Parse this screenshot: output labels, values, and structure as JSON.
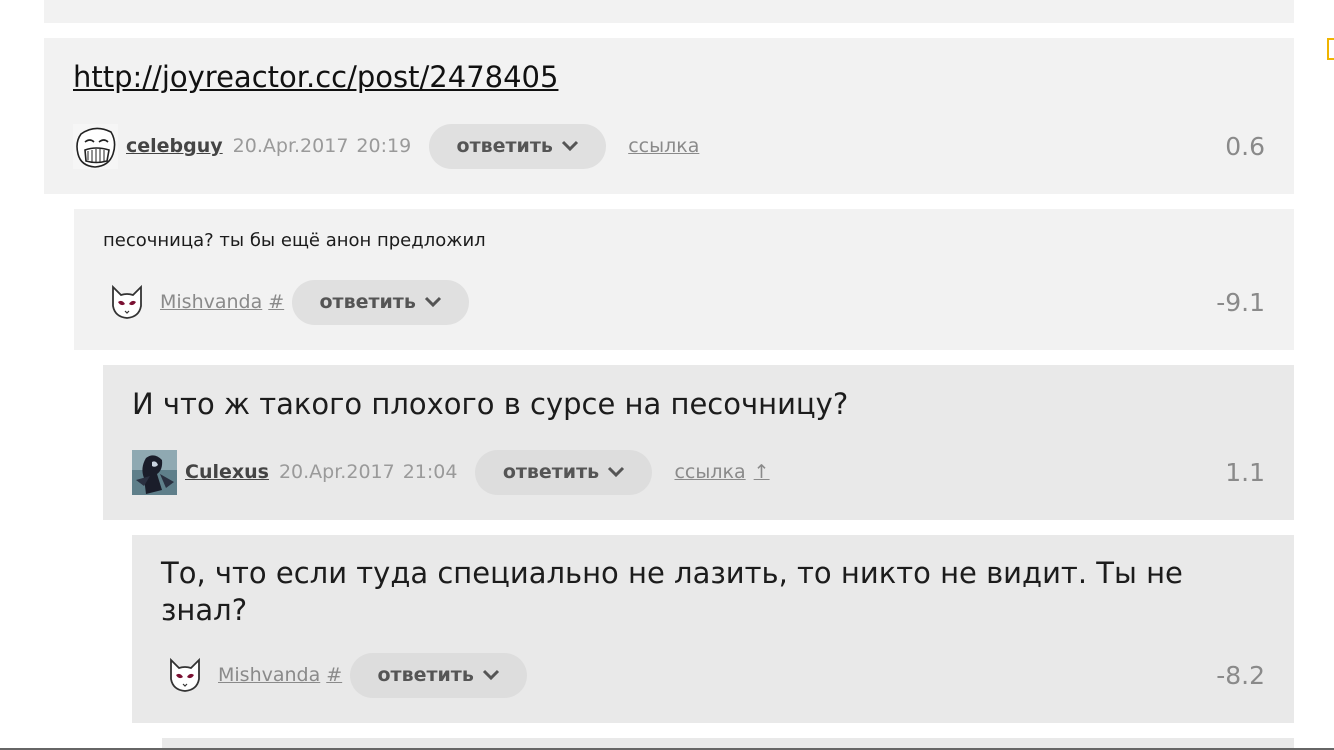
{
  "comments": [
    {
      "text": "http://joyreactor.cc/post/2478405",
      "author": "celebguy",
      "date": "20.Apr.2017",
      "time": "20:19",
      "reply_label": "ответить",
      "link_label": "ссылка",
      "rating": "0.6"
    },
    {
      "text": "песочница? ты бы ещё анон предложил",
      "author": "Mishvanda",
      "hash": "#",
      "reply_label": "ответить",
      "rating": "-9.1"
    },
    {
      "text": "И что ж такого плохого в сурсе на песочницу?",
      "author": "Culexus",
      "date": "20.Apr.2017",
      "time": "21:04",
      "reply_label": "ответить",
      "link_label": "ссылка",
      "up_label": "↑",
      "rating": "1.1"
    },
    {
      "text": "То, что если туда специально не лазить, то никто не видит. Ты не знал?",
      "author": "Mishvanda",
      "hash": "#",
      "reply_label": "ответить",
      "rating": "-8.2"
    }
  ],
  "icons": {
    "chevron": "chevron-down-icon",
    "avatar_troll": "troll-face-avatar",
    "avatar_cat": "cat-face-avatar",
    "avatar_dark": "dark-character-avatar"
  },
  "colors": {
    "panel_light": "#f2f2f2",
    "panel_dark": "#e9e9e9",
    "button_bg": "#e0e0e0",
    "muted_text": "#8a8a8a",
    "edge_accent": "#f0b400"
  }
}
